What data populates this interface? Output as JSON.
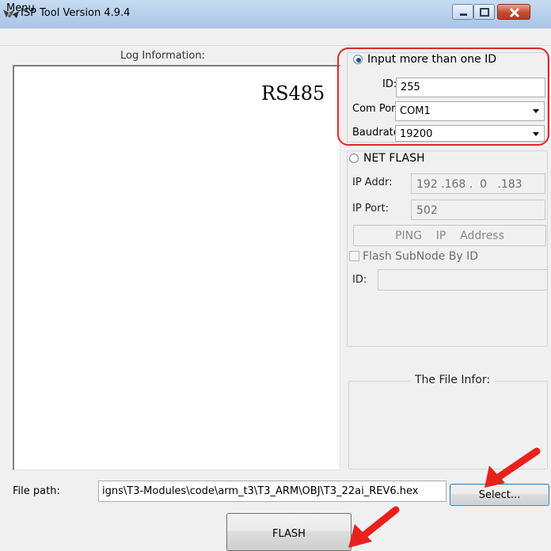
{
  "window": {
    "title": "ISP Tool Version 4.9.4",
    "controls": {
      "minimize": "minimize",
      "maximize": "maximize",
      "close": "close"
    }
  },
  "menu": {
    "items": [
      "Menu"
    ]
  },
  "log": {
    "label": "Log Information:"
  },
  "annotation": {
    "rs485": "RS485"
  },
  "serial": {
    "mode_label": "Input more than one ID",
    "mode_selected": true,
    "id_label": "ID:",
    "id_value": "255",
    "com_label": "Com Port:",
    "com_value": "COM1",
    "baud_label": "Baudrate:",
    "baud_value": "19200"
  },
  "net": {
    "mode_label": "NET FLASH",
    "mode_selected": false,
    "ip_label": "IP Addr:",
    "ip_value": "192 .168 .  0   .183",
    "port_label": "IP Port:",
    "port_value": "502",
    "ping_label": "PING    IP    Address",
    "subnode_label": "Flash SubNode By ID",
    "subnode_checked": false,
    "sub_id_label": "ID:",
    "sub_id_value": ""
  },
  "file_info": {
    "legend": "The File Infor:"
  },
  "bottom": {
    "path_label": "File path:",
    "path_value": "igns\\T3-Modules\\code\\arm_t3\\T3_ARM\\OBJ\\T3_22ai_REV6.hex",
    "select_label": "Select...",
    "flash_label": "FLASH"
  },
  "colors": {
    "highlight": "#e0262b",
    "accent": "#3c7fb1"
  }
}
